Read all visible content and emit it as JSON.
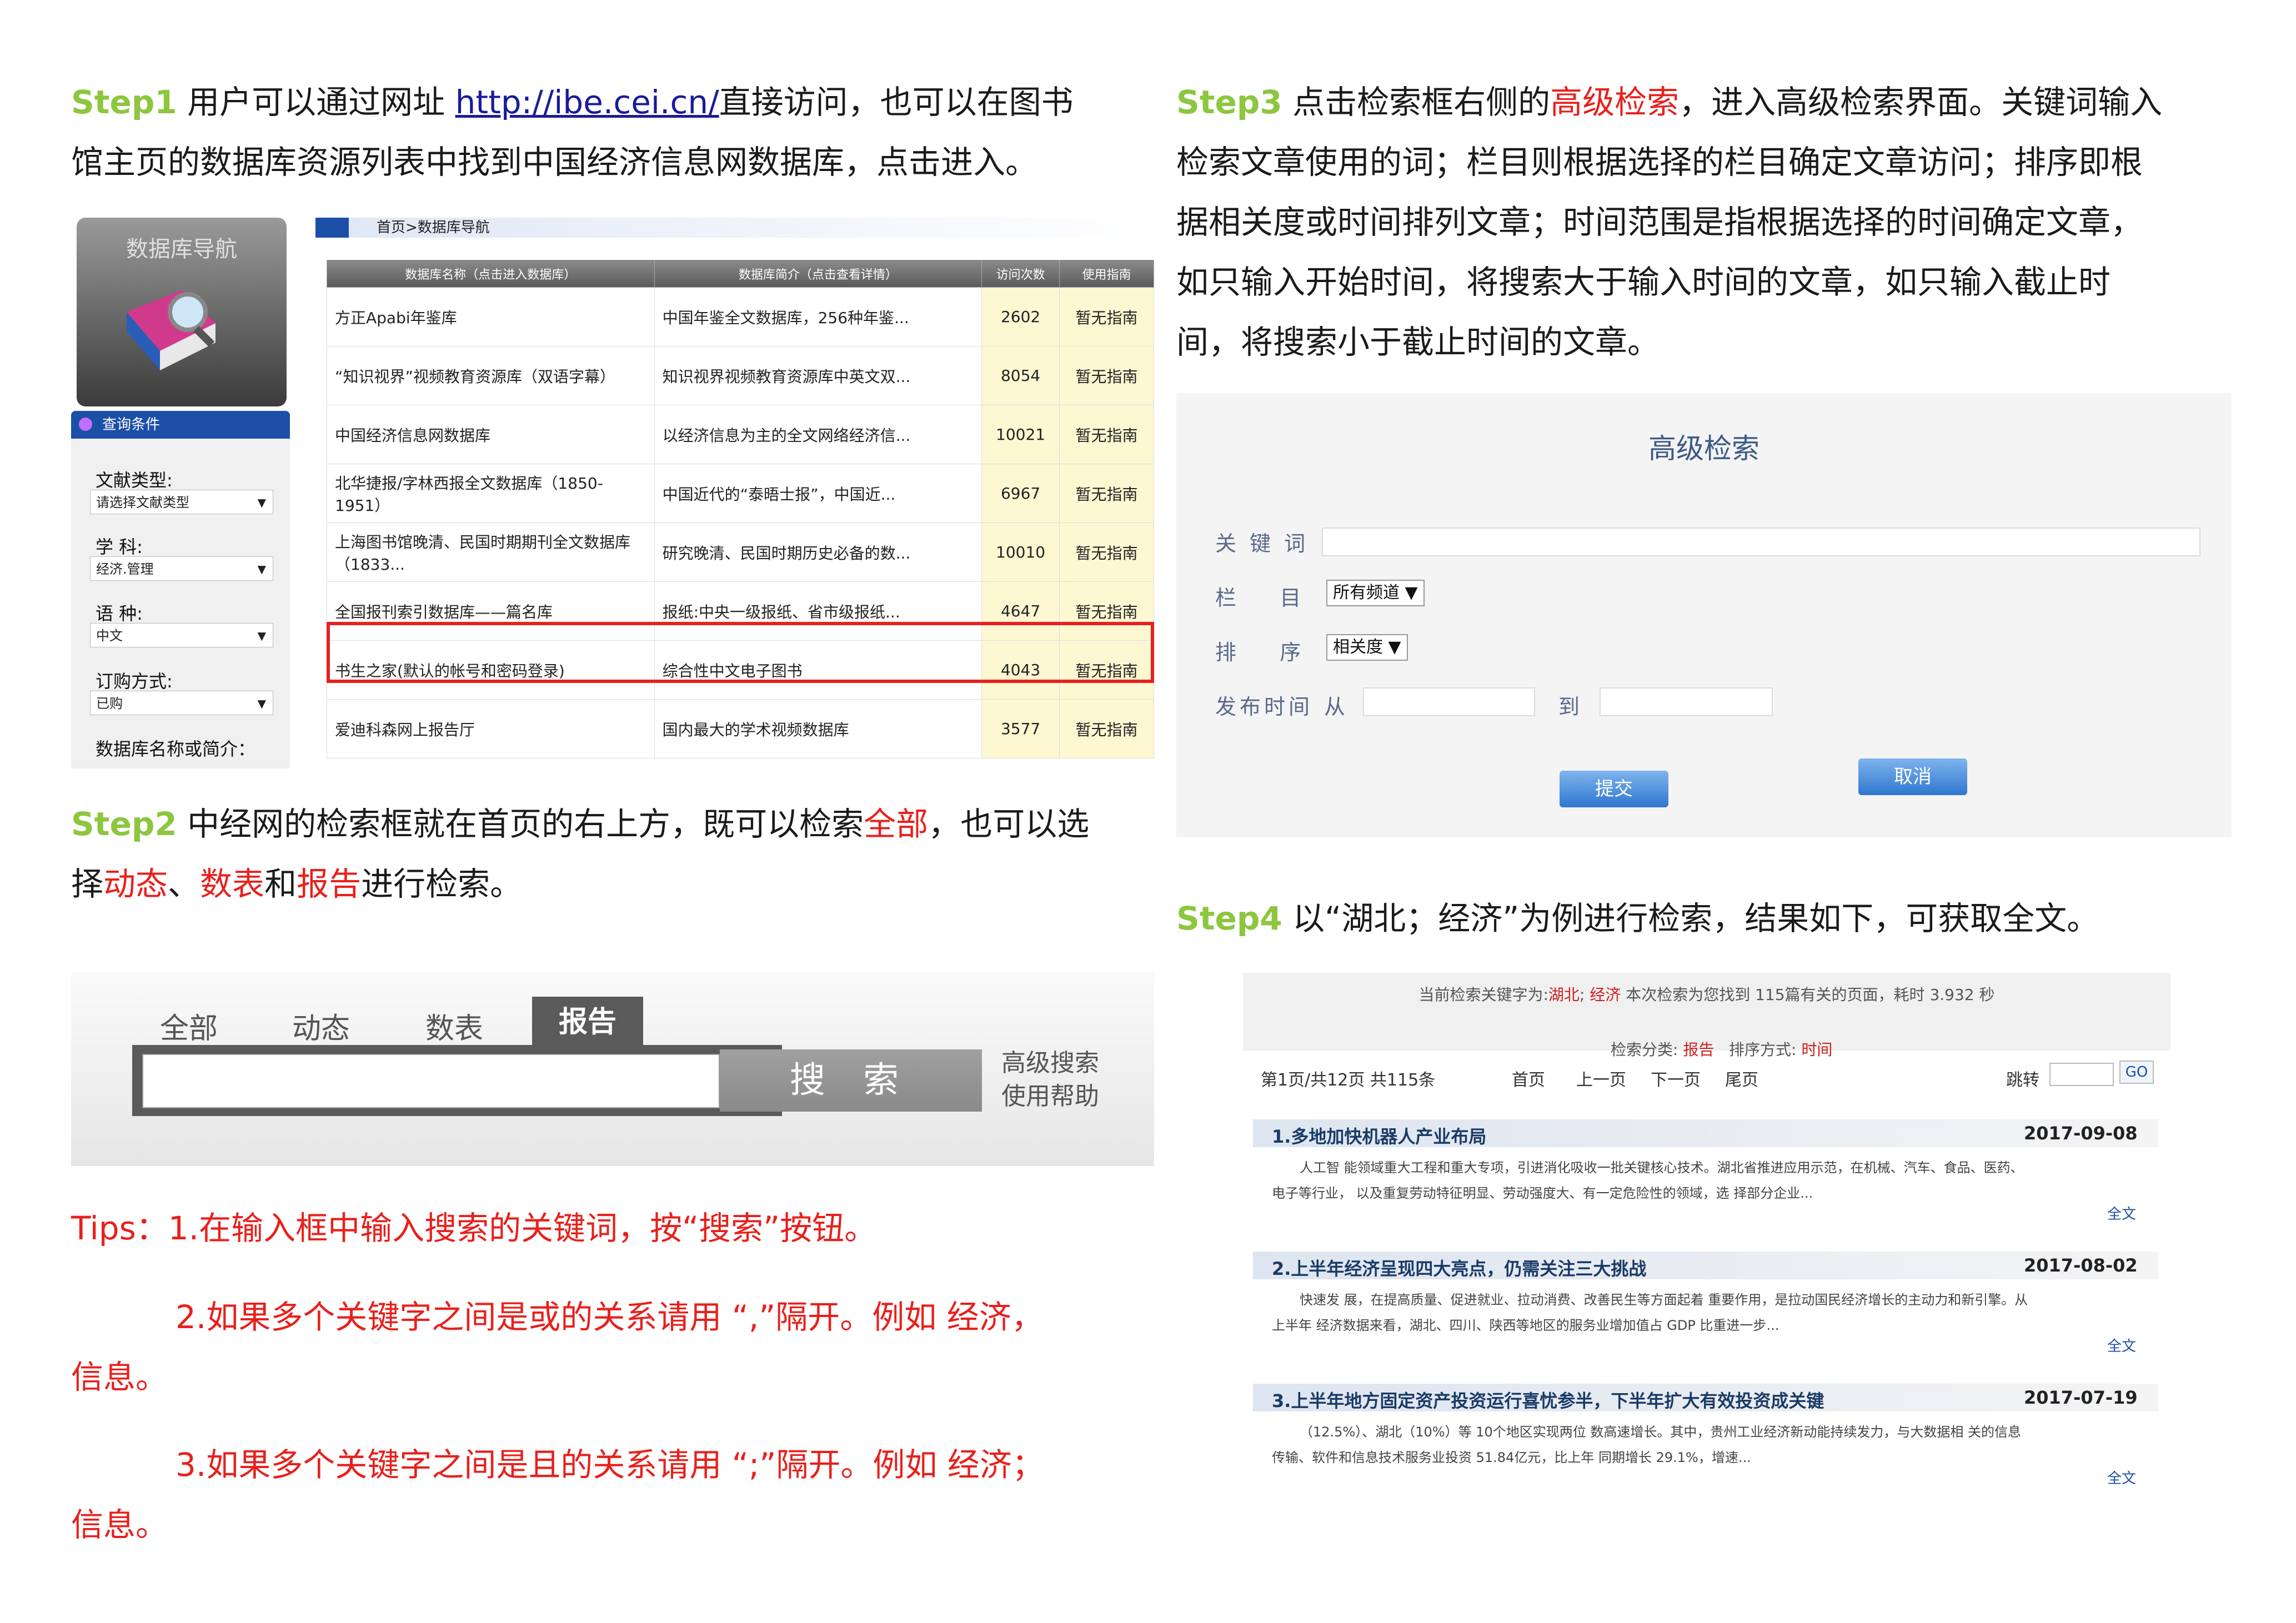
{
  "step1": {
    "step_label": "Step1",
    "text_before_link": " 用户可以通过网址 ",
    "link": "http://ibe.cei.cn/",
    "text_after_link": "直接访问，也可以在图书",
    "line2": "馆主页的数据库资源列表中找到中国经济信息网数据库，点击进入。",
    "screenshot": {
      "nav_title": "数据库导航",
      "query_bar": "查询条件",
      "filters": [
        {
          "label": "文献类型:",
          "value": "请选择文献类型"
        },
        {
          "label": "学  科:",
          "value": "经济.管理"
        },
        {
          "label": "语  种:",
          "value": "中文"
        },
        {
          "label": "订购方式:",
          "value": "已购"
        }
      ],
      "last_label": "数据库名称或简介：",
      "breadcrumb": "首页>数据库导航",
      "columns": [
        "数据库名称（点击进入数据库）",
        "数据库简介（点击查看详情）",
        "访问次数",
        "使用指南"
      ],
      "rows": [
        {
          "name": "方正Apabi年鉴库",
          "desc": "中国年鉴全文数据库，256种年鉴...",
          "visits": "2602",
          "guide": "暂无指南"
        },
        {
          "name": "“知识视界”视频教育资源库（双语字幕）",
          "desc": "知识视界视频教育资源库中英文双...",
          "visits": "8054",
          "guide": "暂无指南"
        },
        {
          "name": "中国经济信息网数据库",
          "desc": "以经济信息为主的全文网络经济信...",
          "visits": "10021",
          "guide": "暂无指南"
        },
        {
          "name": "北华捷报/字林西报全文数据库（1850-1951）",
          "desc": "中国近代的“泰晤士报”，中国近...",
          "visits": "6967",
          "guide": "暂无指南"
        },
        {
          "name": "上海图书馆晚清、民国时期期刊全文数据库（1833...",
          "desc": "研究晚清、民国时期历史必备的数...",
          "visits": "10010",
          "guide": "暂无指南"
        },
        {
          "name": "全国报刊索引数据库——篇名库",
          "desc": "报纸:中央一级报纸、省市级报纸...",
          "visits": "4647",
          "guide": "暂无指南"
        },
        {
          "name": "书生之家(默认的帐号和密码登录)",
          "desc": "综合性中文电子图书",
          "visits": "4043",
          "guide": "暂无指南"
        },
        {
          "name": "爱迪科森网上报告厅",
          "desc": "国内最大的学术视频数据库",
          "visits": "3577",
          "guide": "暂无指南"
        }
      ]
    }
  },
  "step2": {
    "step_label": "Step2",
    "t1": " 中经网的检索框就在首页的右上方，既可以检索",
    "r1": "全部",
    "t2": "，也可以选",
    "t3": "择",
    "r2": "动态",
    "t4": "、",
    "r3": "数表",
    "t5": "和",
    "r4": "报告",
    "t6": "进行检索。",
    "screenshot": {
      "tabs": [
        "全部",
        "动态",
        "数表"
      ],
      "active_tab": "报告",
      "search_button": "搜 索",
      "advanced": "高级搜索",
      "help": "使用帮助"
    }
  },
  "tips": {
    "t1": "Tips：1.在输入框中输入搜索的关键词，按“搜索”按钮。",
    "t2a": "2.如果多个关键字之间是或的关系请用 “,”隔开。例如 经济，",
    "t2b": "信息。",
    "t3a": "3.如果多个关键字之间是且的关系请用 “;”隔开。例如 经济；",
    "t3b": "信息。"
  },
  "step3": {
    "step_label": "Step3",
    "t1": " 点击检索框右侧的",
    "r1": "高级检索",
    "t2": "，进入高级检索界面。关键词输入",
    "lines": [
      "检索文章使用的词；栏目则根据选择的栏目确定文章访问；排序即根",
      "据相关度或时间排列文章；时间范围是指根据选择的时间确定文章，",
      "如只输入开始时间，将搜索大于输入时间的文章，如只输入截止时",
      "间，将搜索小于截止时间的文章。"
    ],
    "screenshot": {
      "title": "高级检索",
      "keyword_label": "关 键 词",
      "column_label": "栏    目",
      "column_value": "所有频道 ▼",
      "order_label": "排    序",
      "order_value": "相关度 ▼",
      "time_label": "发布时间",
      "from": "从",
      "to": "到",
      "submit": "提交",
      "cancel": "取消"
    }
  },
  "step4": {
    "step_label": "Step4",
    "text": " 以“湖北；经济”为例进行检索，结果如下，可获取全文。",
    "screenshot": {
      "summary_a": "当前检索关键字为:",
      "kw1": "湖北",
      "sep": "; ",
      "kw2": "经济",
      "summary_b": "  本次检索为您找到 115篇有关的页面，耗时 3.932 秒",
      "cat_label": "检索分类: ",
      "cat_value": "报告",
      "order_label": "   排序方式: ",
      "order_value": "时间",
      "page_info": "第1页/共12页  共115条",
      "first": "首页",
      "prev": "上一页",
      "next": "下一页",
      "last": "尾页",
      "jump": "跳转",
      "go": "GO",
      "results": [
        {
          "title": "1.多地加快机器人产业布局",
          "date": "2017-09-08",
          "line1": "人工智 能领域重大工程和重大专项，引进消化吸收一批关键核心技术。湖北省推进应用示范，在机械、汽车、食品、医药、",
          "line2": "电子等行业， 以及重复劳动特征明显、劳动强度大、有一定危险性的领域，选 择部分企业...",
          "full": "全文"
        },
        {
          "title": "2.上半年经济呈现四大亮点，仍需关注三大挑战",
          "date": "2017-08-02",
          "line1": "快速发 展，在提高质量、促进就业、拉动消费、改善民生等方面起着 重要作用，是拉动国民经济增长的主动力和新引擎。从",
          "line2": "上半年 经济数据来看，湖北、四川、陕西等地区的服务业增加值占 GDP 比重进一步...",
          "full": "全文"
        },
        {
          "title": "3.上半年地方固定资产投资运行喜忧参半，下半年扩大有效投资成关键",
          "date": "2017-07-19",
          "line1": "（12.5%）、湖北（10%）等 10个地区实现两位 数高速增长。其中，贵州工业经济新动能持续发力，与大数据相 关的信息",
          "line2": "传输、软件和信息技术服务业投资 51.84亿元，比上年 同期增长 29.1%，增速...",
          "full": "全文"
        }
      ]
    }
  }
}
